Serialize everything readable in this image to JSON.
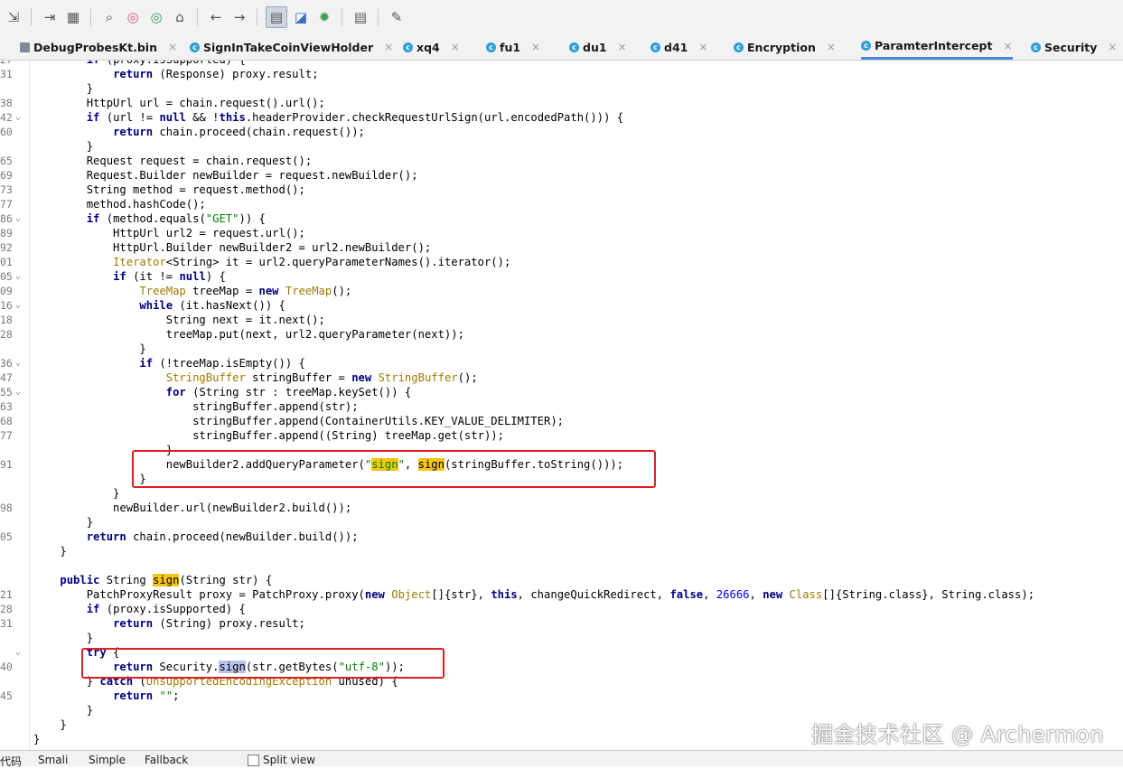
{
  "toolbar": {
    "icons": [
      "export-icon",
      "step-icon",
      "structure-icon",
      "search-icon",
      "find-usage-icon",
      "find-class-icon",
      "home-icon",
      "back-icon",
      "forward-icon",
      "sync-icon",
      "decompile-icon",
      "debug-icon",
      "log-icon",
      "settings-icon"
    ]
  },
  "tabs": [
    {
      "label": "DebugProbesKt.bin",
      "icon": "file-icon",
      "close": "×"
    },
    {
      "label": "SignInTakeCoinViewHolder",
      "icon": "class-icon",
      "close": "×"
    },
    {
      "label": "xq4",
      "icon": "class-icon",
      "close": "×"
    },
    {
      "label": "fu1",
      "icon": "class-icon",
      "close": "×"
    },
    {
      "label": "du1",
      "icon": "class-icon",
      "close": "×"
    },
    {
      "label": "d41",
      "icon": "class-icon",
      "close": "×"
    },
    {
      "label": "Encryption",
      "icon": "class-icon",
      "close": "×"
    },
    {
      "label": "ParamterIntercept",
      "icon": "class-icon",
      "close": "×"
    },
    {
      "label": "Security",
      "icon": "class-icon",
      "close": "×"
    }
  ],
  "active_tab": "ParamterIntercept",
  "gutter": {
    "line_numbers": [
      "27",
      "31",
      "",
      "38",
      "42",
      "60",
      "",
      "65",
      "69",
      "73",
      "77",
      "86",
      "89",
      "92",
      "01",
      "05",
      "09",
      "16",
      "18",
      "28",
      "",
      "36",
      "47",
      "55",
      "63",
      "68",
      "77",
      "",
      "91",
      "",
      "",
      "98",
      "",
      "05",
      "",
      "",
      "",
      "21",
      "28",
      "31",
      "",
      "",
      "40",
      "",
      "45",
      "",
      "",
      ""
    ]
  },
  "code_lines": [
    "        if (proxy.isSupported) {",
    "            return (Response) proxy.result;",
    "        }",
    "        HttpUrl url = chain.request().url();",
    "        if (url != null && !this.headerProvider.checkRequestUrlSign(url.encodedPath())) {",
    "            return chain.proceed(chain.request());",
    "        }",
    "        Request request = chain.request();",
    "        Request.Builder newBuilder = request.newBuilder();",
    "        String method = request.method();",
    "        method.hashCode();",
    "        if (method.equals(\"GET\")) {",
    "            HttpUrl url2 = request.url();",
    "            HttpUrl.Builder newBuilder2 = url2.newBuilder();",
    "            Iterator<String> it = url2.queryParameterNames().iterator();",
    "            if (it != null) {",
    "                TreeMap treeMap = new TreeMap();",
    "                while (it.hasNext()) {",
    "                    String next = it.next();",
    "                    treeMap.put(next, url2.queryParameter(next));",
    "                }",
    "                if (!treeMap.isEmpty()) {",
    "                    StringBuffer stringBuffer = new StringBuffer();",
    "                    for (String str : treeMap.keySet()) {",
    "                        stringBuffer.append(str);",
    "                        stringBuffer.append(ContainerUtils.KEY_VALUE_DELIMITER);",
    "                        stringBuffer.append((String) treeMap.get(str));",
    "                    }",
    "                    newBuilder2.addQueryParameter(\"sign\", sign(stringBuffer.toString()));",
    "                }",
    "            }",
    "            newBuilder.url(newBuilder2.build());",
    "        }",
    "        return chain.proceed(newBuilder.build());",
    "    }",
    "",
    "    public String sign(String str) {",
    "        PatchProxyResult proxy = PatchProxy.proxy(new Object[]{str}, this, changeQuickRedirect, false, 26666, new Class[]{String.class}, String.class);",
    "        if (proxy.isSupported) {",
    "            return (String) proxy.result;",
    "        }",
    "        try {",
    "            return Security.sign(str.getBytes(\"utf-8\"));",
    "        } catch (UnsupportedEncodingException unused) {",
    "            return \"\";",
    "        }",
    "    }",
    "}"
  ],
  "bottom_bar": {
    "tabs": [
      "代码",
      "Smali",
      "Simple",
      "Fallback"
    ],
    "split_view_label": "Split view"
  },
  "watermark": "掘金技术社区 @ Archermon",
  "colors": {
    "accent": "#4a89dc",
    "highlight": "#f5c518",
    "annotation": "#e02020",
    "keyword": "#000080",
    "string": "#008000",
    "number": "#0000ff"
  }
}
